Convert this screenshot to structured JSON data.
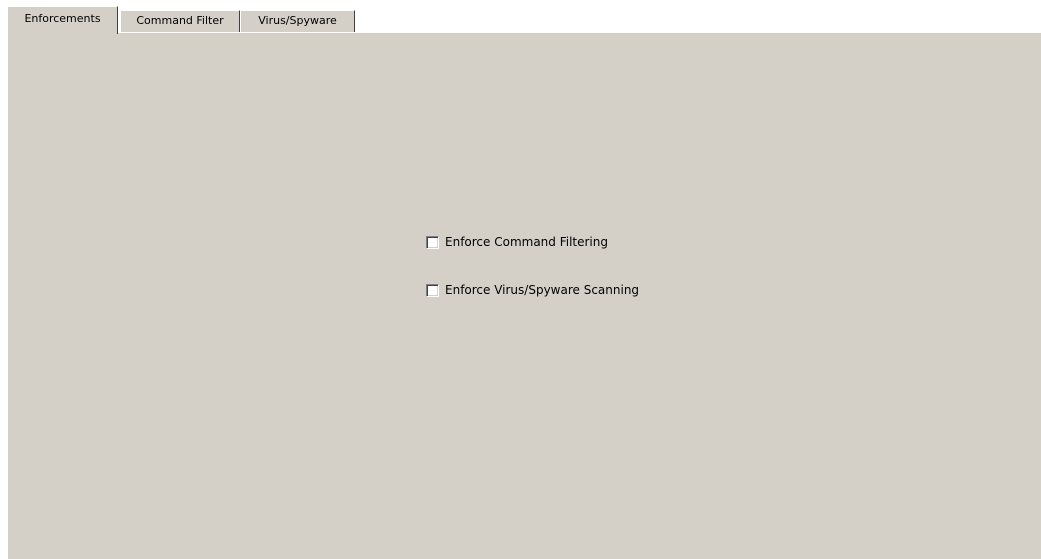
{
  "tabs": [
    {
      "label": "Enforcements",
      "active": true
    },
    {
      "label": "Command Filter",
      "active": false
    },
    {
      "label": "Virus/Spyware",
      "active": false
    }
  ],
  "enforcements": {
    "options": [
      {
        "label": "Enforce Command Filtering",
        "checked": false
      },
      {
        "label": "Enforce Virus/Spyware Scanning",
        "checked": false
      }
    ]
  },
  "colors": {
    "panel_background": "#d4d0c8",
    "window_background": "#ffffff"
  }
}
